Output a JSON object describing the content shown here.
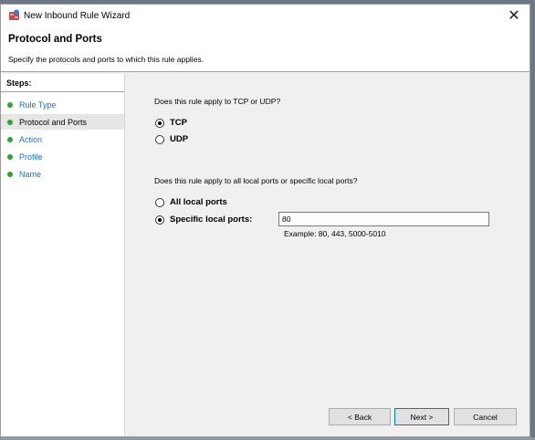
{
  "window": {
    "title": "New Inbound Rule Wizard",
    "close_glyph": "✕"
  },
  "header": {
    "title": "Protocol and Ports",
    "subtitle": "Specify the protocols and ports to which this rule applies."
  },
  "steps": {
    "title": "Steps:",
    "items": [
      {
        "label": "Rule Type",
        "current": false
      },
      {
        "label": "Protocol and Ports",
        "current": true
      },
      {
        "label": "Action",
        "current": false
      },
      {
        "label": "Profile",
        "current": false
      },
      {
        "label": "Name",
        "current": false
      }
    ]
  },
  "protocol": {
    "question": "Does this rule apply to TCP or UDP?",
    "options": [
      {
        "label": "TCP",
        "selected": true
      },
      {
        "label": "UDP",
        "selected": false
      }
    ]
  },
  "ports": {
    "question": "Does this rule apply to all local ports or specific local ports?",
    "options": [
      {
        "label": "All local ports",
        "selected": false
      },
      {
        "label": "Specific local ports:",
        "selected": true
      }
    ],
    "value": "80",
    "example": "Example: 80, 443, 5000-5010"
  },
  "buttons": {
    "back": "< Back",
    "next": "Next >",
    "cancel": "Cancel"
  },
  "colors": {
    "step_dot": "#27a627",
    "step_link": "#1f6fc4",
    "default_button_border": "#0078d7"
  }
}
